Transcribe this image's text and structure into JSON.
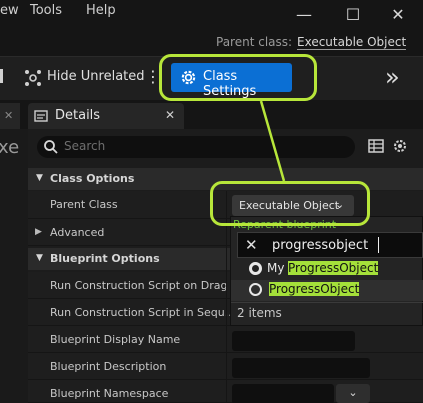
{
  "menu": {
    "items": [
      "ew",
      "Tools",
      "Help"
    ]
  },
  "window_controls": {
    "minimize": "—",
    "maximize": "☐",
    "close": "✕"
  },
  "parent_bar": {
    "label": "Parent class:",
    "value": "Executable Object"
  },
  "toolbar": {
    "hide_unrelated": "Hide Unrelated",
    "class_settings": "Class Settings",
    "more": "⋮",
    "overflow": "»"
  },
  "tabs": {
    "details": "Details",
    "left_partial": "xe"
  },
  "search": {
    "placeholder": "Search"
  },
  "sections": {
    "class_options": "Class Options",
    "blueprint_options": "Blueprint Options"
  },
  "rows": {
    "parent_class": "Parent Class",
    "parent_class_value": "Executable Object",
    "advanced": "Advanced",
    "run_construction_drag": "Run Construction Script on Drag",
    "run_construction_seq": "Run Construction Script in Sequ...",
    "display_name": "Blueprint Display Name",
    "description": "Blueprint Description",
    "namespace": "Blueprint Namespace"
  },
  "popup": {
    "header": "Reparent blueprint",
    "query": "progressobject",
    "items": [
      {
        "prefix": "My",
        "match": "ProgressObject"
      },
      {
        "prefix": "",
        "match": "ProgressObject"
      }
    ],
    "count": "2 items"
  },
  "colors": {
    "accent": "#0b6fd4",
    "highlight": "#a4e03a",
    "annotation": "#b7e63a"
  }
}
